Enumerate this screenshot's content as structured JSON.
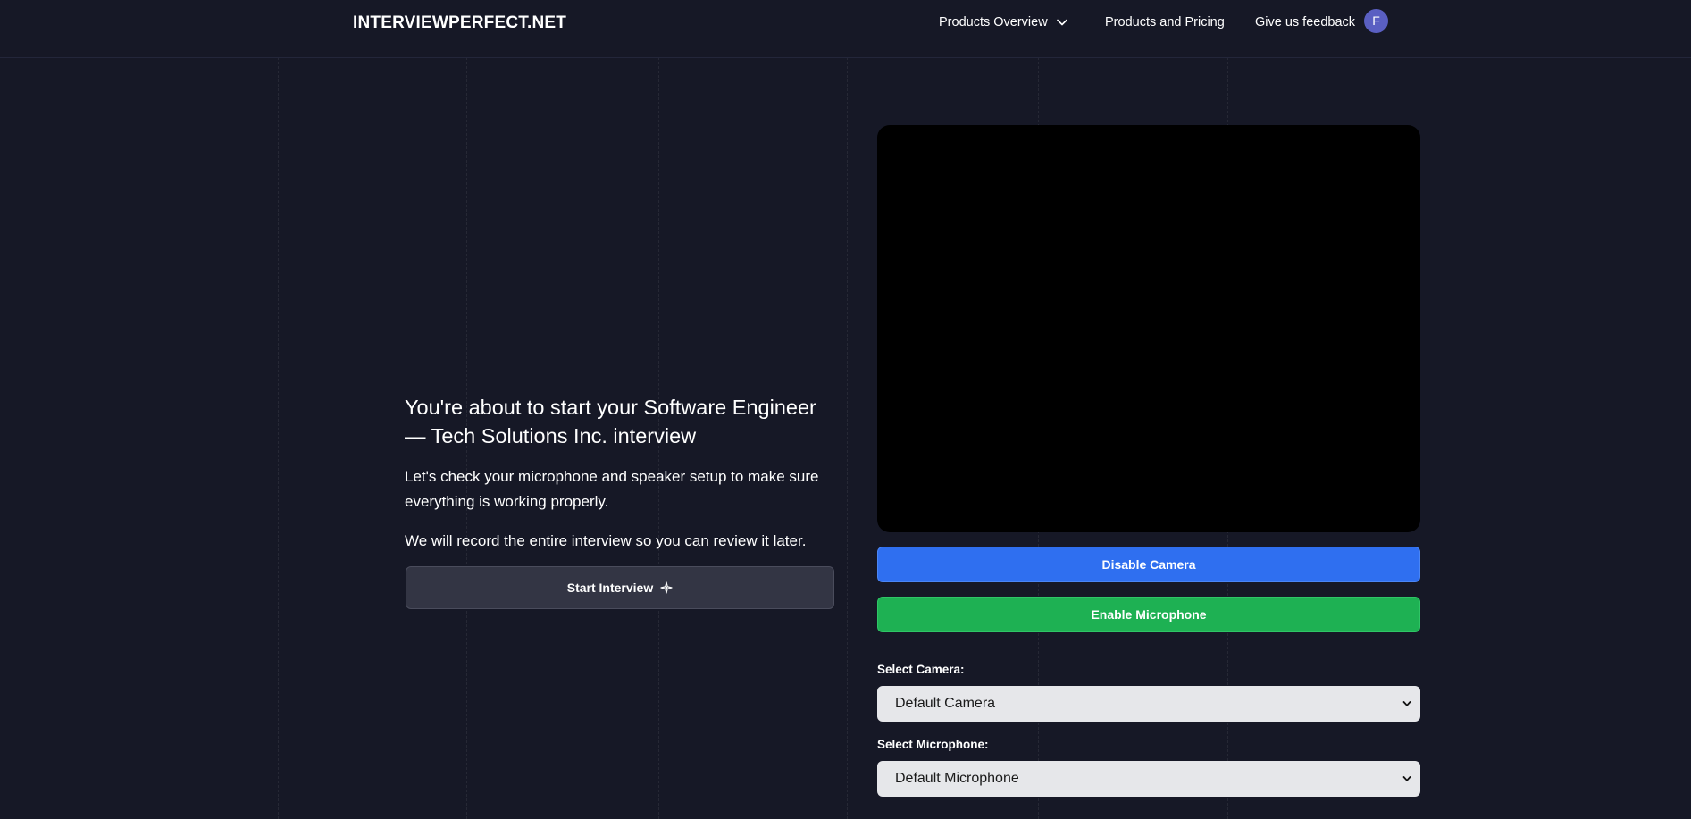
{
  "navbar": {
    "logo": "INTERVIEWPERFECT.NET",
    "products_overview": "Products Overview",
    "products_pricing": "Products and Pricing",
    "feedback": "Give us feedback",
    "avatar_initial": "F"
  },
  "intro": {
    "title": "You're about to start your Software Engineer — Tech Solutions Inc. interview",
    "check_text": "Let's check your microphone and speaker setup to make sure everything is working properly.",
    "record_text": "We will record the entire interview so you can review it later.",
    "start_button": "Start Interview",
    "start_icon": "sparkle-icon"
  },
  "media": {
    "disable_camera_button": "Disable Camera",
    "enable_microphone_button": "Enable Microphone",
    "camera_label": "Select Camera:",
    "camera_selected": "Default Camera",
    "microphone_label": "Select Microphone:",
    "microphone_selected": "Default Microphone"
  },
  "colors": {
    "background": "#161826",
    "camera_button": "#2f6ff0",
    "microphone_button": "#1eb153",
    "avatar": "#5a5fc2",
    "video_preview": "#000000"
  }
}
